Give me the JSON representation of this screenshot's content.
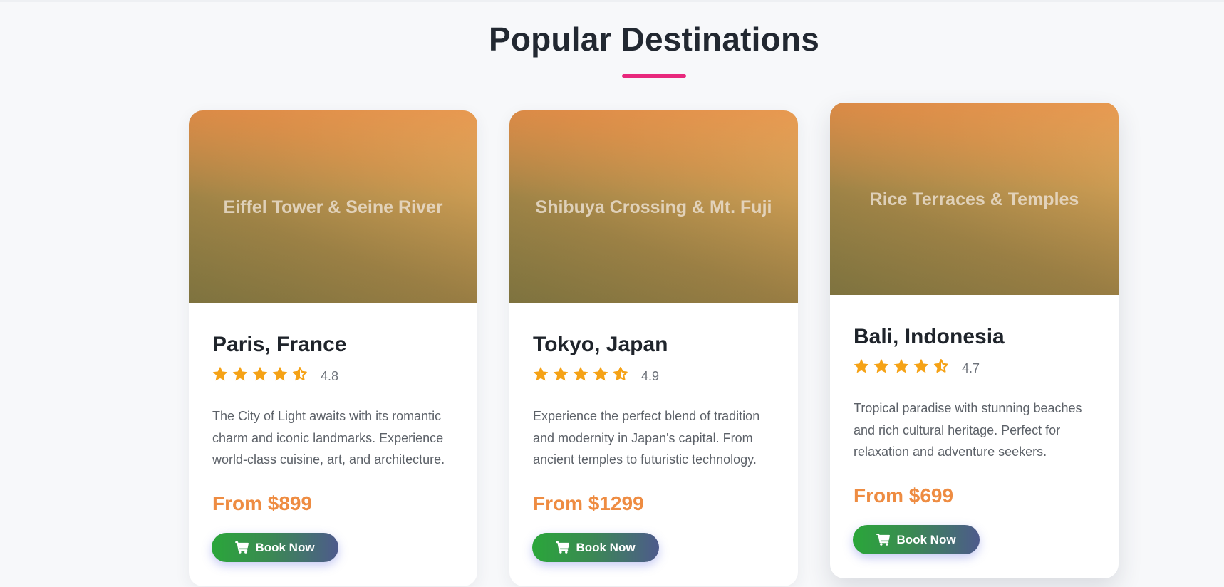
{
  "section": {
    "title": "Popular Destinations",
    "accent_color": "#e8287c"
  },
  "colors": {
    "star": "#f5a216",
    "price": "#ee8c42",
    "button_start": "#2aa63a",
    "button_end": "#4e5a8c"
  },
  "icons": {
    "star": "star-icon",
    "half_star": "star-half-icon",
    "cart": "shopping-cart-icon"
  },
  "cards": [
    {
      "image_caption": "Eiffel Tower & Seine River",
      "title": "Paris, France",
      "stars": 4.5,
      "rating": "4.8",
      "description": "The City of Light awaits with its romantic charm and iconic landmarks. Experience world-class cuisine, art, and architecture.",
      "price": "From $899",
      "button_label": "Book Now"
    },
    {
      "image_caption": "Shibuya Crossing & Mt. Fuji",
      "title": "Tokyo, Japan",
      "stars": 4.5,
      "rating": "4.9",
      "description": "Experience the perfect blend of tradition and modernity in Japan's capital. From ancient temples to futuristic technology.",
      "price": "From $1299",
      "button_label": "Book Now"
    },
    {
      "image_caption": "Rice Terraces & Temples",
      "title": "Bali, Indonesia",
      "stars": 4.5,
      "rating": "4.7",
      "description": "Tropical paradise with stunning beaches and rich cultural heritage. Perfect for relaxation and adventure seekers.",
      "price": "From $699",
      "button_label": "Book Now"
    }
  ]
}
